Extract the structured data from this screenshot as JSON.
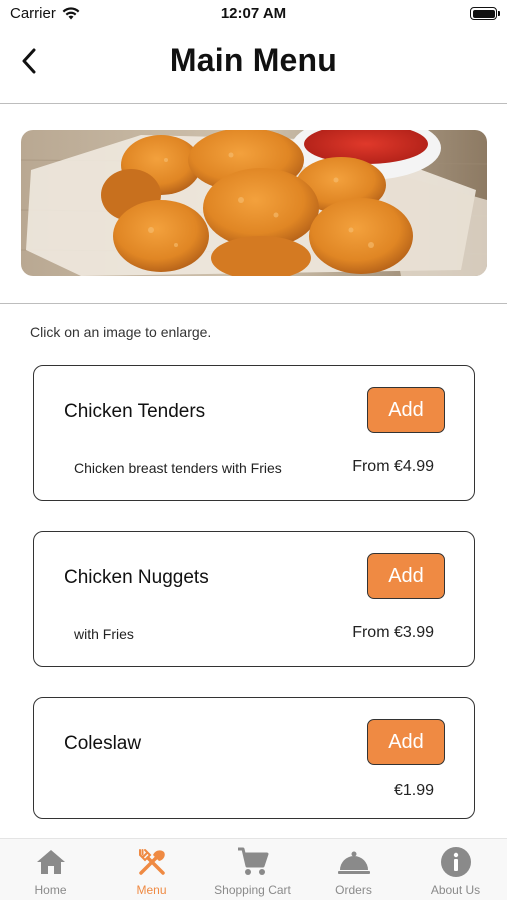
{
  "status_bar": {
    "carrier": "Carrier",
    "time": "12:07 AM",
    "battery_level": 1.0
  },
  "header": {
    "title": "Main Menu",
    "back_icon": "chevron-left-icon"
  },
  "hero": {
    "image_subject": "chicken nuggets with ketchup dip"
  },
  "hint": "Click on an image to enlarge.",
  "menu_items": [
    {
      "name": "Chicken Tenders",
      "description": "Chicken breast tenders with Fries",
      "price": "From €4.99",
      "add_label": "Add"
    },
    {
      "name": "Chicken Nuggets",
      "description": "with Fries",
      "price": "From €3.99",
      "add_label": "Add"
    },
    {
      "name": "Coleslaw",
      "description": "",
      "price": "€1.99",
      "add_label": "Add"
    }
  ],
  "tab_bar": {
    "active_tab": "Menu",
    "tabs": [
      {
        "label": "Home",
        "icon": "home-icon"
      },
      {
        "label": "Menu",
        "icon": "fork-knife-icon"
      },
      {
        "label": "Shopping Cart",
        "icon": "cart-icon"
      },
      {
        "label": "Orders",
        "icon": "cloche-icon"
      },
      {
        "label": "About Us",
        "icon": "info-icon"
      }
    ]
  },
  "colors": {
    "accent": "#ef8a43",
    "inactive_tab": "#8a8a8a",
    "border": "#333333"
  }
}
